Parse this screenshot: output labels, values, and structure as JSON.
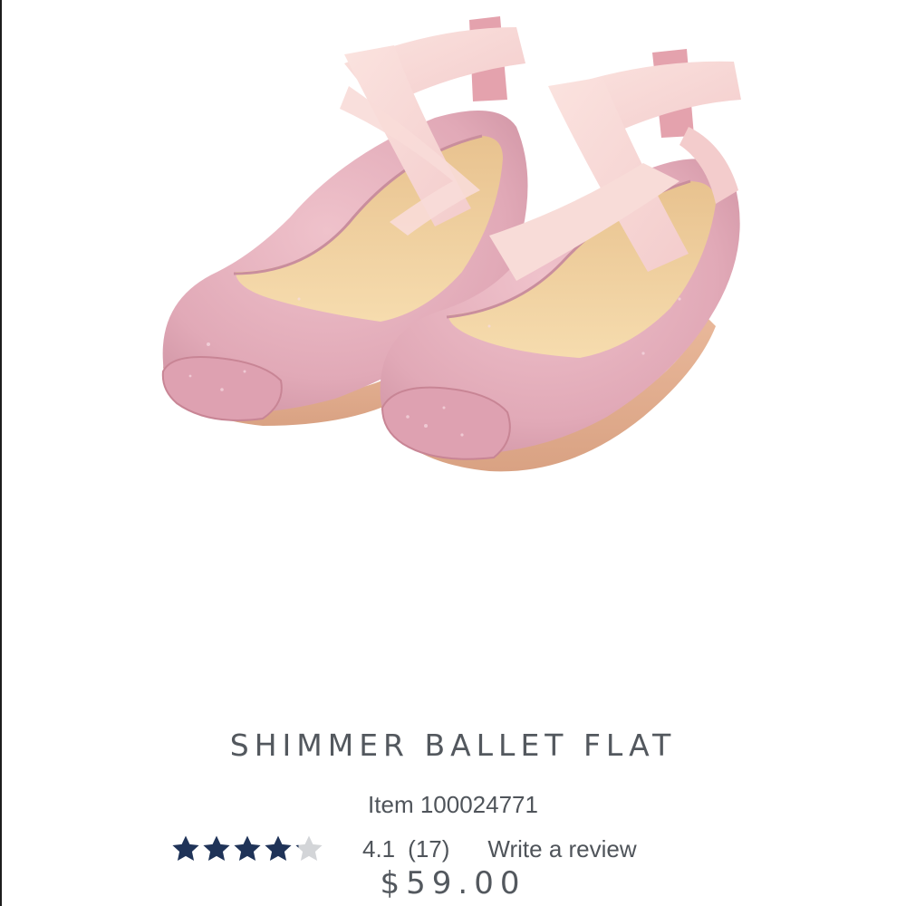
{
  "product": {
    "title": "SHIMMER BALLET FLAT",
    "item_label": "Item 100024771",
    "rating_value": "4.1",
    "review_count": "(17)",
    "write_review_label": "Write a review",
    "price": "$59.00",
    "rating": 4.1,
    "rating_max": 5
  },
  "icons": {
    "star": "star-icon"
  },
  "colors": {
    "star_filled": "#1f3358",
    "star_empty": "#d3d5d8",
    "text": "#4f545a",
    "shoe_pink": "#e2aebb",
    "strap_pink": "#f6d6d6"
  }
}
